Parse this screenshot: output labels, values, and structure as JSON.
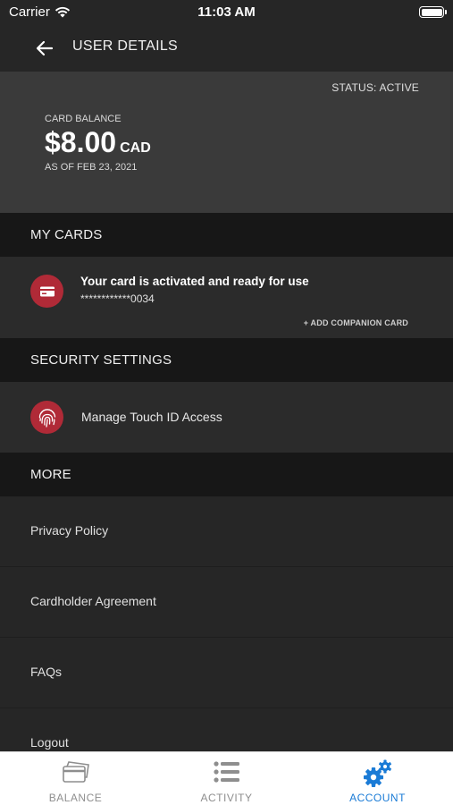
{
  "status_bar": {
    "carrier": "Carrier",
    "time": "11:03 AM"
  },
  "header": {
    "title": "USER DETAILS"
  },
  "balance": {
    "status": "STATUS: ACTIVE",
    "label": "CARD BALANCE",
    "amount": "$8.00",
    "currency": "CAD",
    "as_of": "AS OF FEB 23, 2021"
  },
  "my_cards": {
    "heading": "MY CARDS",
    "message": "Your card is activated and ready for use",
    "card_number": "************0034",
    "companion_link": "+ ADD COMPANION CARD"
  },
  "security": {
    "heading": "SECURITY SETTINGS",
    "touch_id_label": "Manage Touch ID Access"
  },
  "more": {
    "heading": "MORE",
    "items": [
      {
        "label": "Privacy Policy"
      },
      {
        "label": "Cardholder Agreement"
      },
      {
        "label": "FAQs"
      },
      {
        "label": "Logout"
      }
    ]
  },
  "tabs": [
    {
      "label": "BALANCE",
      "icon": "card-stack-icon",
      "active": false
    },
    {
      "label": "ACTIVITY",
      "icon": "list-icon",
      "active": false
    },
    {
      "label": "ACCOUNT",
      "icon": "gears-icon",
      "active": true
    }
  ],
  "colors": {
    "background": "#262626",
    "section_header": "#171717",
    "balance_panel": "#3a3a3a",
    "icon_red": "#b02a37",
    "active_tab": "#1a7bd6",
    "inactive_tab": "#8e8e8e"
  }
}
